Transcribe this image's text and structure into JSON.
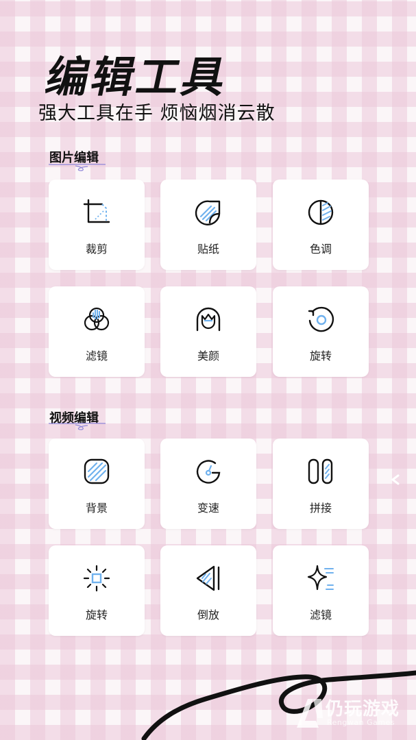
{
  "header": {
    "title": "编辑工具",
    "subtitle": "强大工具在手 烦恼烟消云散"
  },
  "sections": [
    {
      "title": "图片编辑",
      "tools": [
        {
          "label": "裁剪",
          "icon": "crop-icon"
        },
        {
          "label": "贴纸",
          "icon": "sticker-icon"
        },
        {
          "label": "色调",
          "icon": "color-tone-icon"
        },
        {
          "label": "滤镜",
          "icon": "filter-icon"
        },
        {
          "label": "美颜",
          "icon": "beauty-face-icon"
        },
        {
          "label": "旋转",
          "icon": "rotate-icon"
        }
      ]
    },
    {
      "title": "视频编辑",
      "tools": [
        {
          "label": "背景",
          "icon": "background-icon"
        },
        {
          "label": "变速",
          "icon": "speed-change-icon"
        },
        {
          "label": "拼接",
          "icon": "splice-icon"
        },
        {
          "label": "旋转",
          "icon": "sun-rotate-icon"
        },
        {
          "label": "倒放",
          "icon": "reverse-play-icon"
        },
        {
          "label": "滤镜",
          "icon": "sparkle-filter-icon"
        }
      ]
    }
  ],
  "watermark": {
    "name": "仍玩游戏",
    "sub": "Rengwan Games"
  },
  "colors": {
    "accent_blue": "#6fb1ee",
    "underline_purple": "#8f86d8",
    "icon_stroke": "#111111",
    "card_bg": "#ffffff",
    "gingham_pink": "#ecc8da"
  }
}
